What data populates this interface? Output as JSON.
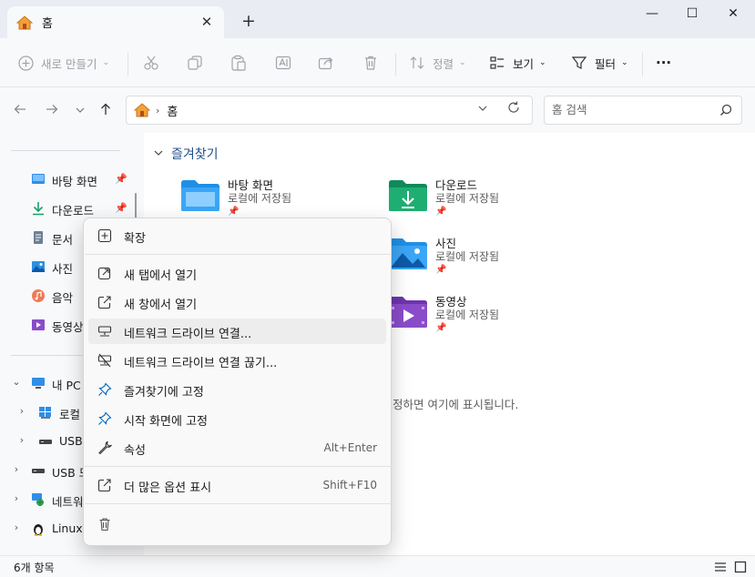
{
  "window": {
    "tab_title": "홈",
    "tab_close": "✕",
    "new_tab": "+",
    "controls": {
      "minimize": "—",
      "maximize": "☐",
      "close": "✕"
    }
  },
  "toolbar": {
    "new_label": "새로 만들기",
    "sort_label": "정렬",
    "view_label": "보기",
    "filter_label": "필터",
    "more_label": "···",
    "chev": "⌄"
  },
  "address": {
    "path": "홈",
    "separator": "›",
    "search_placeholder": "홈 검색"
  },
  "sidebar": {
    "quick_items": [
      {
        "label": "바탕 화면",
        "icon": "desktop-icon"
      },
      {
        "label": "다운로드",
        "icon": "download-icon"
      },
      {
        "label": "문서",
        "icon": "document-icon"
      },
      {
        "label": "사진",
        "icon": "pictures-icon"
      },
      {
        "label": "음악",
        "icon": "music-icon"
      },
      {
        "label": "동영상",
        "icon": "videos-icon"
      }
    ],
    "tree_items": [
      {
        "label": "내 PC",
        "expander": "⌄"
      },
      {
        "label": "로컬",
        "expander": "›"
      },
      {
        "label": "USB",
        "expander": "›"
      },
      {
        "label": "USB 드",
        "expander": "›"
      },
      {
        "label": "네트워",
        "expander": "›"
      },
      {
        "label": "Linux",
        "expander": "›"
      }
    ]
  },
  "main": {
    "section_title": "즐겨찾기",
    "tiles": [
      {
        "name": "바탕 화면",
        "sub": "로컬에 저장됨"
      },
      {
        "name": "다운로드",
        "sub": "로컬에 저장됨"
      },
      {
        "name": "사진",
        "sub": "로컬에 저장됨"
      },
      {
        "name": "동영상",
        "sub": "로컬에 저장됨"
      }
    ],
    "empty_hint": "을 고정하면 여기에 표시됩니다."
  },
  "context_menu": {
    "items": [
      {
        "label": "확장",
        "icon": "expand-icon"
      },
      {
        "label": "새 탭에서 열기",
        "icon": "open-new-tab-icon"
      },
      {
        "label": "새 창에서 열기",
        "icon": "open-new-window-icon"
      },
      {
        "label": "네트워크 드라이브 연결...",
        "icon": "map-network-drive-icon"
      },
      {
        "label": "네트워크 드라이브 연결 끊기...",
        "icon": "disconnect-network-drive-icon"
      },
      {
        "label": "즐겨찾기에 고정",
        "icon": "pin-icon"
      },
      {
        "label": "시작 화면에 고정",
        "icon": "pin-start-icon"
      },
      {
        "label": "속성",
        "icon": "wrench-icon",
        "shortcut": "Alt+Enter"
      },
      {
        "label": "더 많은 옵션 표시",
        "icon": "more-options-icon",
        "shortcut": "Shift+F10"
      }
    ],
    "highlighted_index": 3
  },
  "status": {
    "item_count": "6개 항목"
  },
  "colors": {
    "accent": "#0067c0",
    "folder_blue": "#1f8fe6",
    "folder_green": "#18a06a",
    "folder_purple": "#8a4cc9"
  }
}
